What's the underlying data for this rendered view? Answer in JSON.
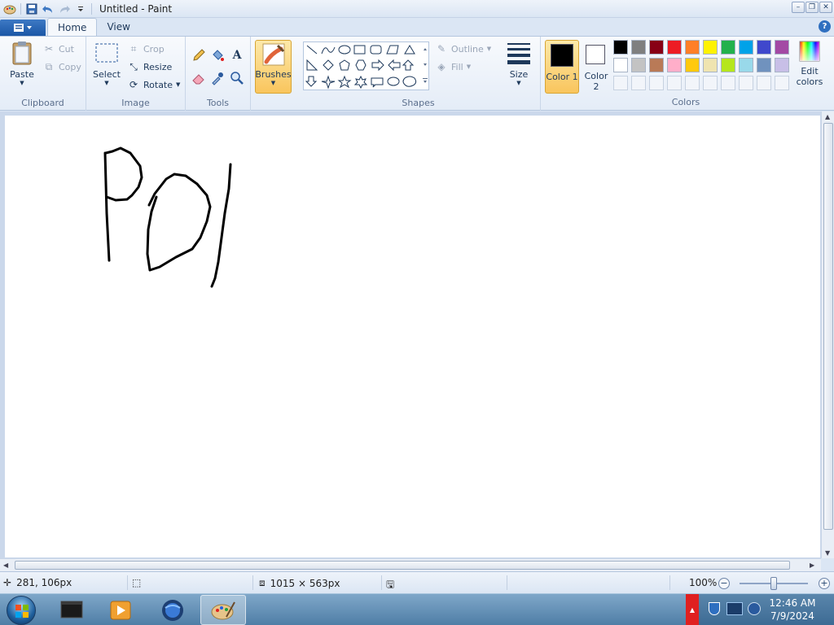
{
  "window": {
    "title": "Untitled - Paint",
    "controls": [
      "minimize",
      "maximize",
      "close"
    ]
  },
  "quick_access": {
    "icons": [
      "paint-icon",
      "save-icon",
      "undo-icon",
      "redo-icon",
      "customize-icon"
    ]
  },
  "tabs": [
    {
      "label": "Home",
      "active": true
    },
    {
      "label": "View",
      "active": false
    }
  ],
  "ribbon": {
    "clipboard": {
      "label": "Clipboard",
      "paste": "Paste",
      "cut": "Cut",
      "copy": "Copy"
    },
    "image": {
      "label": "Image",
      "select": "Select",
      "crop": "Crop",
      "resize": "Resize",
      "rotate": "Rotate"
    },
    "tools": {
      "label": "Tools",
      "icons": [
        "pencil-icon",
        "fill-icon",
        "text-icon",
        "eraser-icon",
        "color-picker-icon",
        "magnifier-icon"
      ]
    },
    "brushes": {
      "label": "Brushes"
    },
    "shapes": {
      "label": "Shapes",
      "outline": "Outline",
      "fill": "Fill"
    },
    "size": {
      "label": "Size"
    },
    "colors": {
      "label": "Colors",
      "color1_label": "Color 1",
      "color2_label": "Color 2",
      "edit_label": "Edit colors",
      "color1_value": "#000000",
      "color2_value": "#ffffff",
      "palette_row1": [
        "#000000",
        "#7f7f7f",
        "#880015",
        "#ed1c24",
        "#ff7f27",
        "#fff200",
        "#22b14c",
        "#00a2e8",
        "#3f48cc",
        "#a349a4"
      ],
      "palette_row2": [
        "#ffffff",
        "#c3c3c3",
        "#b97a57",
        "#ffaec9",
        "#ffc90e",
        "#efe4b0",
        "#b5e61d",
        "#99d9ea",
        "#7092be",
        "#c8bfe7"
      ],
      "palette_row3": [
        "",
        "",
        "",
        "",
        "",
        "",
        "",
        "",
        "",
        ""
      ]
    }
  },
  "status": {
    "position": "281, 106px",
    "selection": "",
    "canvas_size": "1015 × 563px",
    "file_size": "",
    "zoom": "100%",
    "zoom_level": 0.5
  },
  "taskbar": {
    "apps": [
      "terminal-app",
      "media-player-app",
      "browser-app",
      "paint-app"
    ],
    "active_app": "paint-app",
    "time": "12:46 AM",
    "date": "7/9/2024"
  }
}
